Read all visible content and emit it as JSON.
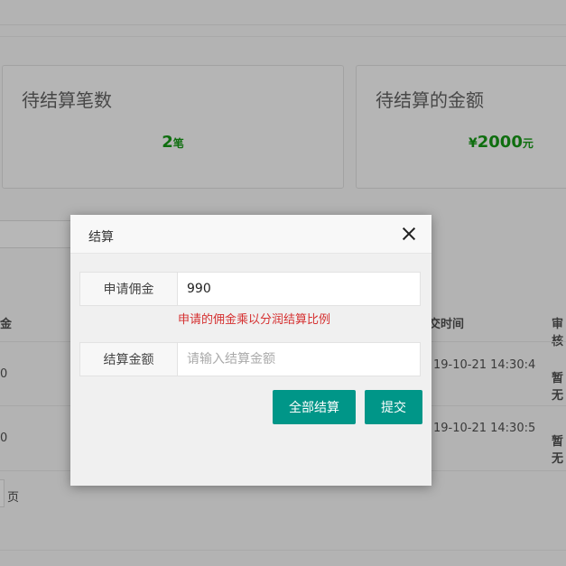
{
  "stats": {
    "pending_count_title": "待结算笔数",
    "pending_count_value": "2",
    "pending_count_unit": "笔",
    "pending_amount_title": "待结算的金额",
    "pending_amount_prefix": "¥",
    "pending_amount_value": "2000",
    "pending_amount_unit": "元"
  },
  "table": {
    "headers": {
      "amount_partial": "金",
      "time_partial": "交时间",
      "audit_partial": "审核"
    },
    "rows": [
      {
        "amount": "0",
        "time": "19-10-21 14:30:4",
        "status": "暂无"
      },
      {
        "amount": "0",
        "time": "19-10-21 14:30:5",
        "status": "暂无"
      }
    ]
  },
  "pager": {
    "page_label": "页"
  },
  "modal": {
    "title": "结算",
    "commission_label": "申请佣金",
    "commission_value": "990",
    "hint": "申请的佣金乘以分润结算比例",
    "settle_label": "结算金额",
    "settle_placeholder": "请输入结算金额",
    "settle_value": "",
    "btn_all": "全部结算",
    "btn_submit": "提交"
  }
}
